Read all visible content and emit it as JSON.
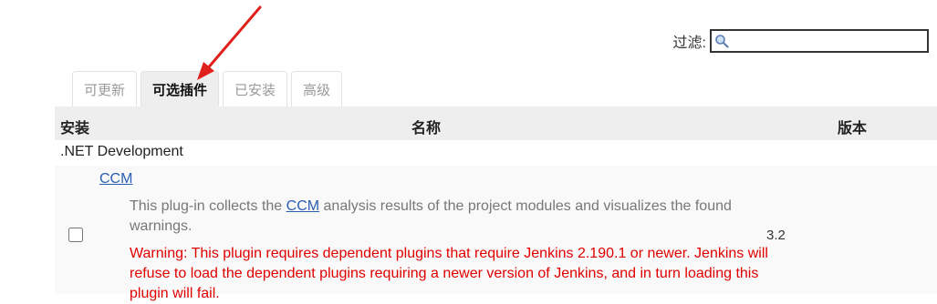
{
  "filter": {
    "label": "过滤:",
    "value": ""
  },
  "tabs": [
    {
      "label": "可更新",
      "active": false
    },
    {
      "label": "可选插件",
      "active": true
    },
    {
      "label": "已安装",
      "active": false
    },
    {
      "label": "高级",
      "active": false
    }
  ],
  "table": {
    "headers": {
      "install": "安装",
      "name": "名称",
      "version": "版本"
    },
    "category": ".NET Development",
    "plugin": {
      "name": "CCM",
      "description_before": "This plug-in collects the ",
      "description_link": "CCM",
      "description_after": " analysis results of the project modules and visualizes the found warnings.",
      "warning": "Warning: This plugin requires dependent plugins that require Jenkins 2.190.1 or newer. Jenkins will refuse to load the dependent plugins requiring a newer version of Jenkins, and in turn loading this plugin will fail.",
      "version": "3.2",
      "checked": false
    }
  },
  "colors": {
    "arrow": "#e0201b",
    "warning": "#e00000",
    "link": "#2a5db0"
  },
  "icons": {
    "filter": "search-icon",
    "annotation": "red-arrow-icon"
  }
}
